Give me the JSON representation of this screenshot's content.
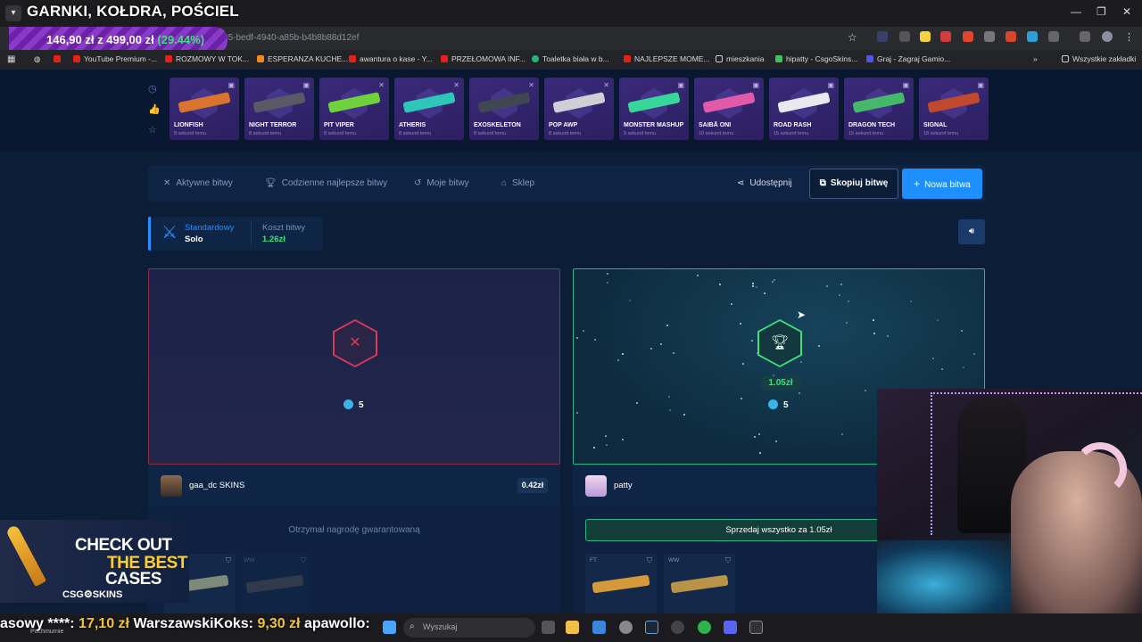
{
  "overlay": {
    "title": "GARNKI, KOŁDRA, POŚCIEL"
  },
  "browser": {
    "url_fragment": "...e/3714b895-bedf-4940-a85b-b4b8b88d12ef",
    "bookmarks": [
      "YouTube Premium -...",
      "ROZMOWY W TOK...",
      "ESPERANZA KUCHE...",
      "awantura o kase - Y...",
      "PRZEŁOMOWA INF...",
      "Toaletka biała w b...",
      "NAJLEPSZE MOME...",
      "mieszkania",
      "hipatty - CsgoSkins...",
      "Graj - Zagraj Gamio..."
    ],
    "all_bookmarks": "Wszystkie zakładki"
  },
  "price_banner": {
    "current": "146,90 zł",
    "sep": "z",
    "goal": "499,00 zł",
    "percent": "(29.44%)"
  },
  "live_drops": [
    {
      "name": "LIONFISH",
      "time": "8 sekund temu",
      "color": "#d8742e"
    },
    {
      "name": "NIGHT TERROR",
      "time": "8 sekund temu",
      "color": "#5a5a66"
    },
    {
      "name": "PIT VIPER",
      "time": "8 sekund temu",
      "color": "#6fd23c"
    },
    {
      "name": "ATHERIS",
      "time": "8 sekund temu",
      "color": "#2ec6b8"
    },
    {
      "name": "EXOSKELETON",
      "time": "8 sekund temu",
      "color": "#404652"
    },
    {
      "name": "POP AWP",
      "time": "8 sekund temu",
      "color": "#cfcfd6"
    },
    {
      "name": "MONSTER MASHUP",
      "time": "9 sekund temu",
      "color": "#38d69a"
    },
    {
      "name": "SAIBĀ ONI",
      "time": "10 sekund temu",
      "color": "#e05aa8"
    },
    {
      "name": "ROAD RASH",
      "time": "15 sekund temu",
      "color": "#e8e8ee"
    },
    {
      "name": "DRAGON TECH",
      "time": "15 sekund temu",
      "color": "#46b86a"
    },
    {
      "name": "SIGNAL",
      "time": "18 sekund temu",
      "color": "#c0482e"
    }
  ],
  "nav": {
    "active": "Aktywne bitwy",
    "daily": "Codzienne najlepsze bitwy",
    "mine": "Moje bitwy",
    "shop": "Sklep",
    "share": "Udostępnij",
    "copy": "Skopiuj bitwę",
    "new": "Nowa bitwa"
  },
  "mode": {
    "label": "Standardowy",
    "value": "Solo",
    "cost_label": "Koszt bitwy",
    "cost_value": "1.26zł"
  },
  "arena": {
    "left": {
      "rounds": "5",
      "status_icon": "close-icon"
    },
    "right": {
      "rounds": "5",
      "winnings": "1.05zł",
      "status_icon": "trophy-icon"
    }
  },
  "players": [
    {
      "name": "gaa_dc SKINS",
      "value": "0.42zł",
      "note": "Otrzymał nagrodę gwarantowaną",
      "items": [
        {
          "cond": "",
          "color": "#7d8a7a"
        },
        {
          "cond": "WW",
          "color": "#5a5a5a"
        }
      ]
    },
    {
      "name": "patty",
      "sell_label": "Sprzedaj wszystko za 1.05zł",
      "items": [
        {
          "cond": "FT",
          "color": "#d49a3a"
        },
        {
          "cond": "WW",
          "color": "#b99348"
        }
      ]
    }
  ],
  "promo": {
    "line1": "CHECK OUT",
    "line2": "THE BEST",
    "line3": "CASES",
    "brand": "CSG⚙SKINS"
  },
  "ticker": [
    {
      "name": "asowy ****:",
      "amount": "17,10 zł"
    },
    {
      "name": "WarszawskiKoks:",
      "amount": "9,30 zł"
    },
    {
      "name": "apawollo:",
      "amount": ""
    }
  ],
  "taskbar": {
    "weather": "Pochmurnie",
    "search_placeholder": "Wyszukaj"
  }
}
